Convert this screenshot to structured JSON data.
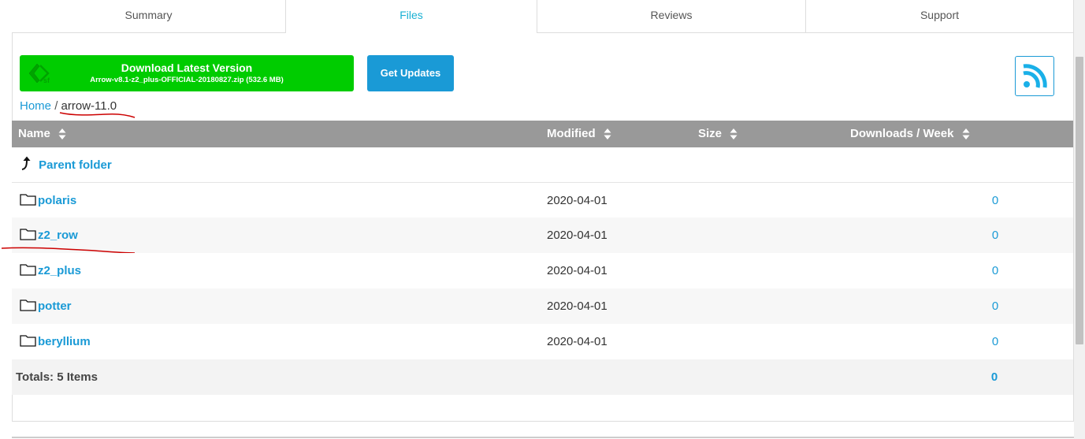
{
  "tabs": [
    {
      "label": "Summary",
      "active": false
    },
    {
      "label": "Files",
      "active": true
    },
    {
      "label": "Reviews",
      "active": false
    },
    {
      "label": "Support",
      "active": false
    }
  ],
  "download": {
    "title": "Download Latest Version",
    "file": "Arrow-v8.1-z2_plus-OFFICIAL-20180827.zip (532.6 MB)",
    "color": "#00cc00",
    "logo_icon": "sf-logo-icon"
  },
  "get_updates": {
    "label": "Get Updates",
    "color": "#1a9ad6"
  },
  "rss": {
    "icon": "rss-icon"
  },
  "breadcrumb": {
    "home": "Home",
    "separator": "/",
    "current": "arrow-11.0"
  },
  "table": {
    "columns": [
      "Name",
      "Modified",
      "Size",
      "Downloads / Week"
    ],
    "parent_folder": "Parent folder",
    "rows": [
      {
        "name": "polaris",
        "modified": "2020-04-01",
        "size": "",
        "downloads": "0"
      },
      {
        "name": "z2_row",
        "modified": "2020-04-01",
        "size": "",
        "downloads": "0"
      },
      {
        "name": "z2_plus",
        "modified": "2020-04-01",
        "size": "",
        "downloads": "0"
      },
      {
        "name": "potter",
        "modified": "2020-04-01",
        "size": "",
        "downloads": "0"
      },
      {
        "name": "beryllium",
        "modified": "2020-04-01",
        "size": "",
        "downloads": "0"
      }
    ],
    "totals_label": "Totals: 5 Items",
    "totals_downloads": "0"
  },
  "colors": {
    "accent": "#1a9ad6",
    "header_bg": "#999999",
    "annotation": "#cc0000"
  }
}
